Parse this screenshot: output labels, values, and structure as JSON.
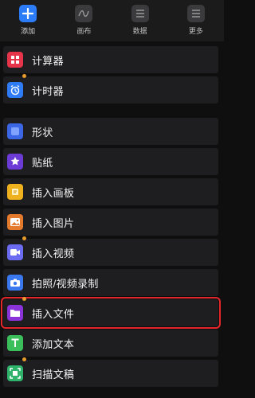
{
  "toolbar": {
    "items": [
      {
        "label": "添加",
        "icon": "plus-icon",
        "active": true
      },
      {
        "label": "画布",
        "icon": "canvas-icon",
        "active": false
      },
      {
        "label": "数据",
        "icon": "data-icon",
        "active": false
      },
      {
        "label": "更多",
        "icon": "more-icon",
        "active": false
      }
    ]
  },
  "groups": [
    {
      "items": [
        {
          "label": "计算器",
          "icon": "calculator-icon",
          "color": "#e6344a",
          "dot": false
        },
        {
          "label": "计时器",
          "icon": "alarm-clock-icon",
          "color": "#2f7bf6",
          "dot": true
        }
      ]
    },
    {
      "items": [
        {
          "label": "形状",
          "icon": "shape-icon",
          "color": "#3b67e6",
          "dot": false
        },
        {
          "label": "贴纸",
          "icon": "sticker-icon",
          "color": "#6c3bd6",
          "dot": false
        },
        {
          "label": "插入画板",
          "icon": "drawing-board-icon",
          "color": "#f0b11f",
          "dot": false
        },
        {
          "label": "插入图片",
          "icon": "image-icon",
          "color": "#e37a2c",
          "dot": false
        },
        {
          "label": "插入视频",
          "icon": "video-icon",
          "color": "#6b6cf2",
          "dot": true
        },
        {
          "label": "拍照/视频录制",
          "icon": "camera-icon",
          "color": "#3a78f0",
          "dot": false
        },
        {
          "label": "插入文件",
          "icon": "folder-icon",
          "color": "#8a33d8",
          "dot": true,
          "highlighted": true
        },
        {
          "label": "添加文本",
          "icon": "text-icon",
          "color": "#3bbf5a",
          "dot": false
        },
        {
          "label": "扫描文稿",
          "icon": "scan-icon",
          "color": "#2fb26a",
          "dot": true
        }
      ]
    }
  ]
}
